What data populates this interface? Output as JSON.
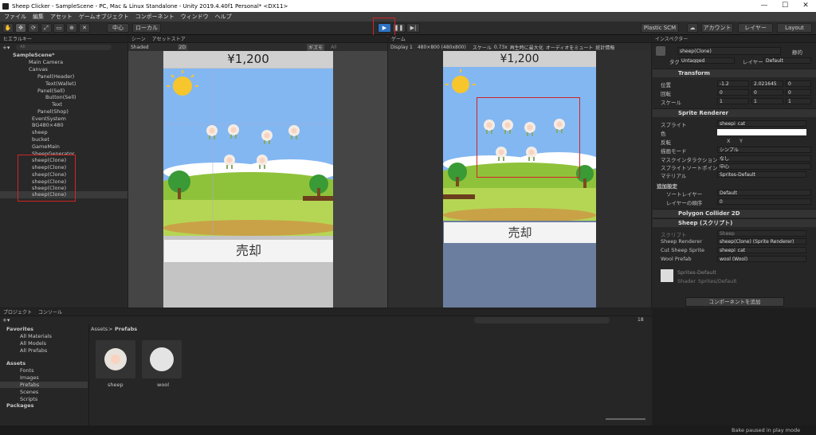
{
  "window": {
    "title": "Sheep Clicker - SampleScene - PC, Mac & Linux Standalone - Unity 2019.4.40f1 Personal* <DX11>",
    "minimize": "—",
    "maximize": "☐",
    "close": "✕"
  },
  "menu": [
    "ファイル",
    "編集",
    "アセット",
    "ゲームオブジェクト",
    "コンポーネント",
    "ウィンドウ",
    "ヘルプ"
  ],
  "toolbar": {
    "pivot": "中心",
    "space": "ローカル",
    "plastic": "Plastic SCM",
    "account": "アカウント",
    "layers": "レイヤー",
    "layout": "Layout",
    "play_icon": "play-icon",
    "pause_icon": "pause-icon",
    "step_icon": "step-icon"
  },
  "hierarchy": {
    "tab": "ヒエラルキー",
    "search_placeholder": "All",
    "items": [
      "SampleScene*",
      "Main Camera",
      "Canvas",
      "Panel(Header)",
      "Text(Wallet)",
      "Panel(Sell)",
      "Button(Sell)",
      "Text",
      "Panel(Shop)",
      "EventSystem",
      "BG480×480",
      "sheep",
      "bucket",
      "GameMain",
      "SheepGenerator",
      "sheep(Clone)",
      "sheep(Clone)",
      "sheep(Clone)",
      "sheep(Clone)",
      "sheep(Clone)",
      "sheep(Clone)"
    ]
  },
  "scene": {
    "tab": "シーン",
    "tab2": "アセットストア",
    "shading": "Shaded",
    "mode2d": "2D",
    "gizmos": "ギズモ",
    "search": "All",
    "wallet": "¥1,200",
    "sell_label": "売却"
  },
  "game": {
    "tab": "ゲーム",
    "display": "Display 1",
    "resolution": "480×800 (480x800)",
    "scale_label": "スケール",
    "scale_value": "0.73x",
    "maximize": "再生時に最大化",
    "mute": "オーディオをミュート",
    "stats": "統計情報",
    "wallet": "¥1,200",
    "sell_label": "売却"
  },
  "inspector": {
    "tab": "インスペクター",
    "object_name": "sheep(Clone)",
    "static": "静的",
    "tag_label": "タグ",
    "tag": "Untagged",
    "layer_label": "レイヤー",
    "layer": "Default",
    "transform": {
      "title": "Transform",
      "pos_label": "位置",
      "rot_label": "回転",
      "scale_label": "スケール",
      "pos": {
        "x": "-1.2",
        "y": "2.021645",
        "z": "0"
      },
      "rot": {
        "x": "0",
        "y": "0",
        "z": "0"
      },
      "scale": {
        "x": "1",
        "y": "1",
        "z": "1"
      }
    },
    "sprite_renderer": {
      "title": "Sprite Renderer",
      "sprite_label": "スプライト",
      "sprite": "sheepi_cat",
      "color_label": "色",
      "flip_label": "反転",
      "flip_x": "X",
      "flip_y": "Y",
      "draw_mode_label": "描画モード",
      "draw_mode": "シンプル",
      "mask_label": "マスクインタラクション",
      "mask": "なし",
      "sort_point_label": "スプライトソートポイント",
      "sort_point": "中心",
      "material_label": "マテリアル",
      "material": "Sprites-Default",
      "additional": "追加設定",
      "sort_layer_label": "ソートレイヤー",
      "sort_layer": "Default",
      "order_label": "レイヤーの順序",
      "order": "0"
    },
    "polygon_collider": {
      "title": "Polygon Collider 2D"
    },
    "sheep_script": {
      "title": "Sheep (スクリプト)",
      "script_label": "スクリプト",
      "script": "Sheep",
      "renderer_label": "Sheep Renderer",
      "renderer": "sheep(Clone) (Sprite Renderer)",
      "cut_label": "Cut Sheep Sprite",
      "cut": "sheepi_cat",
      "wool_label": "Wool Prefab",
      "wool": "wool (Wool)"
    },
    "material_block": {
      "name": "Sprites-Default",
      "shader_label": "Shader",
      "shader": "Sprites/Default"
    },
    "add_component": "コンポーネントを追加"
  },
  "project": {
    "tab": "プロジェクト",
    "tab2": "コンソール",
    "favorites": "Favorites",
    "fav_items": [
      "All Materials",
      "All Models",
      "All Prefabs"
    ],
    "assets": "Assets",
    "asset_items": [
      "Fonts",
      "Images",
      "Prefabs",
      "Scenes",
      "Scripts"
    ],
    "packages": "Packages",
    "breadcrumb_root": "Assets",
    "breadcrumb_sep": ">",
    "breadcrumb_current": "Prefabs",
    "files": [
      "sheep",
      "wool"
    ],
    "count": "18"
  },
  "status": {
    "text": "Bake paused in play mode"
  },
  "colors": {
    "accent": "#2d73c4",
    "highlight": "#d02525",
    "sky": "#83b7f2"
  }
}
